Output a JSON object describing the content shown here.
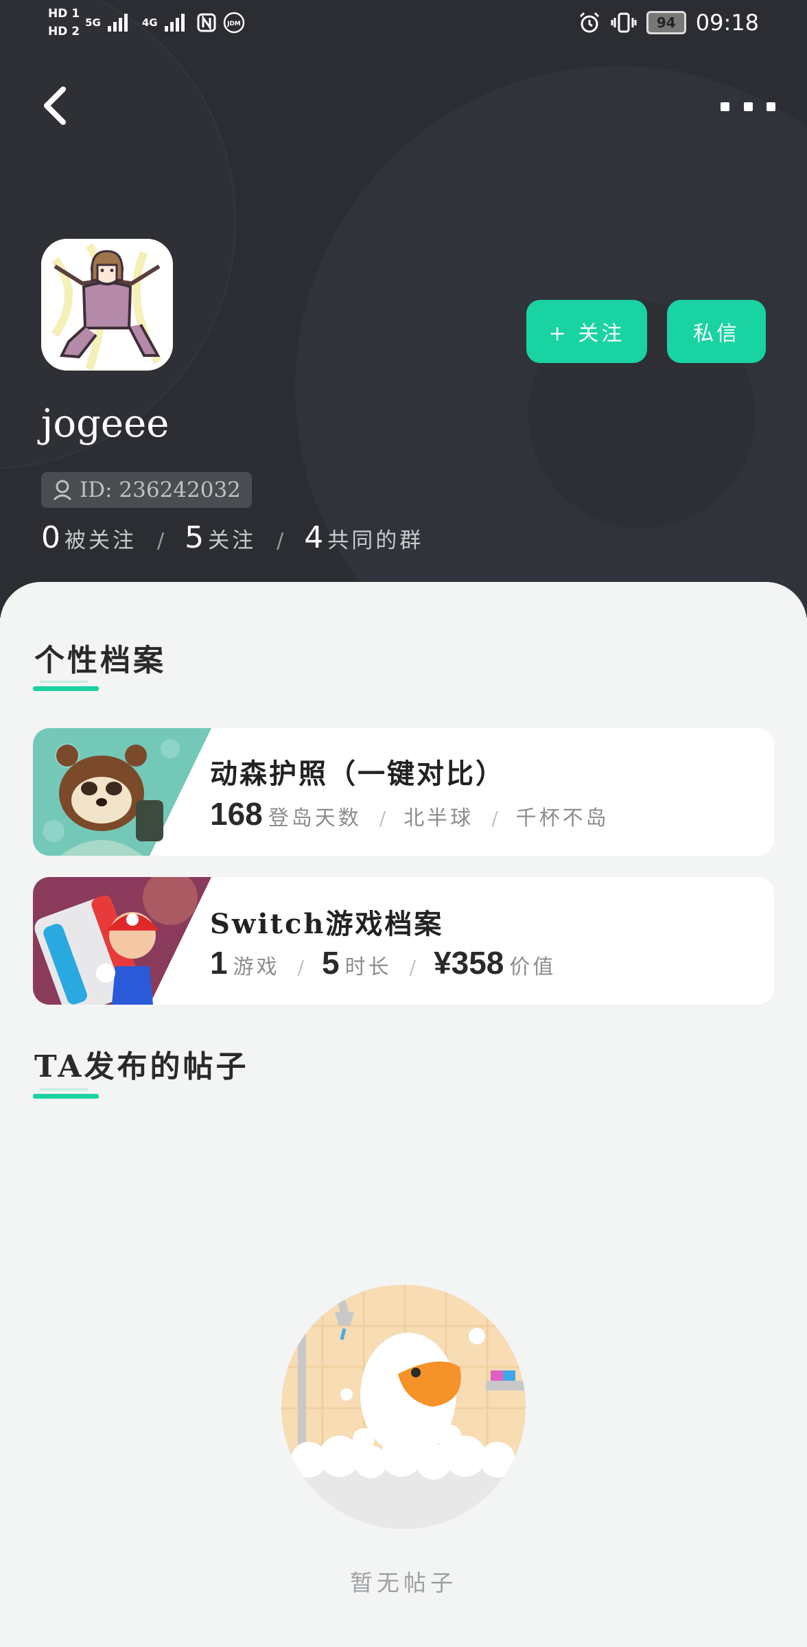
{
  "status_bar": {
    "sim1": "HD 1",
    "sim2": "HD 2",
    "net1": "5G",
    "net2": "4G",
    "battery": "94",
    "time": "09:18"
  },
  "profile": {
    "username": "jogeee",
    "id_text": "ID: 236242032",
    "follow_button": "+ 关注",
    "message_button": "私信",
    "stats": [
      {
        "value": "0",
        "label": "被关注"
      },
      {
        "value": "5",
        "label": "关注"
      },
      {
        "value": "4",
        "label": "共同的群"
      }
    ],
    "stat_separator": "/"
  },
  "archive": {
    "title": "个性档案",
    "cards": [
      {
        "title": "动森护照（一键对比）",
        "stats": [
          {
            "value": "168",
            "label": "登岛天数"
          },
          {
            "value": "",
            "label": "北半球"
          },
          {
            "value": "",
            "label": "千杯不岛"
          }
        ]
      },
      {
        "title": "Switch游戏档案",
        "stats": [
          {
            "value": "1",
            "label": "游戏"
          },
          {
            "value": "5",
            "label": "时长"
          },
          {
            "value": "¥358",
            "label": "价值"
          }
        ]
      }
    ]
  },
  "posts": {
    "title": "TA发布的帖子",
    "empty_text": "暂无帖子"
  },
  "colors": {
    "accent": "#19d3a2",
    "header_bg": "#2b2d33",
    "page_bg": "#f3f4f4"
  },
  "icons": [
    "back-arrow-icon",
    "more-dots-icon",
    "user-id-icon",
    "alarm-icon",
    "vibrate-icon",
    "nfc-icon",
    "battery-icon"
  ]
}
